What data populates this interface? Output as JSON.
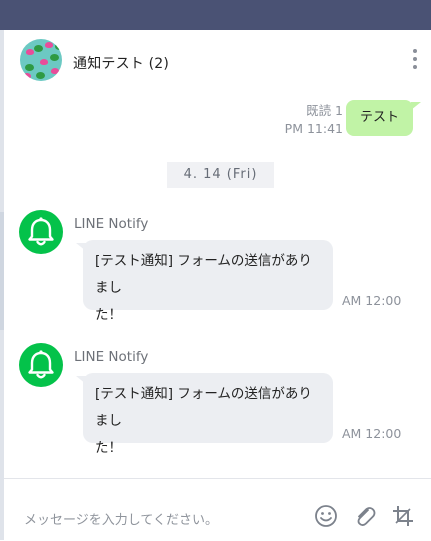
{
  "header": {
    "title": "通知テスト (2)"
  },
  "my_message": {
    "read_status": "既読 1",
    "time": "PM 11:41",
    "text": "テスト"
  },
  "date_separator": "4. 14 (Fri)",
  "messages": [
    {
      "sender": "LINE Notify",
      "line1": "[テスト通知] フォームの送信がありまし",
      "line2": "た！",
      "time": "AM 12:00"
    },
    {
      "sender": "LINE Notify",
      "line1": "[テスト通知] フォームの送信がありまし",
      "line2": "た！",
      "time": "AM 12:00"
    }
  ],
  "input": {
    "placeholder": "メッセージを入力してください。"
  },
  "colors": {
    "topbar": "#4a5274",
    "my_bubble": "#c1f3a6",
    "their_bubble": "#eceef2",
    "line_green": "#04c24a"
  },
  "icons": [
    "more-vertical-icon",
    "bell-icon",
    "emoji-icon",
    "paperclip-icon",
    "crop-icon"
  ]
}
